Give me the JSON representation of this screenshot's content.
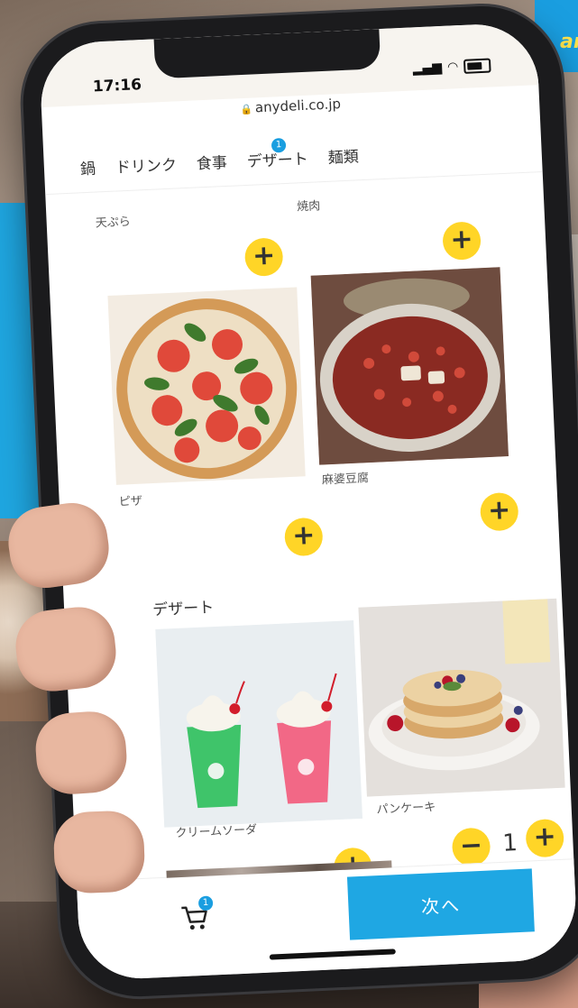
{
  "status": {
    "time": "17:16"
  },
  "url": "anydeli.co.jp",
  "tabs": [
    {
      "label": "鍋"
    },
    {
      "label": "ドリンク"
    },
    {
      "label": "食事"
    },
    {
      "label": "デザート",
      "badge": "1"
    },
    {
      "label": "麺類"
    }
  ],
  "items": {
    "tempura": {
      "label": "天ぷら"
    },
    "yakiniku": {
      "label": "焼肉"
    },
    "pizza": {
      "label": "ピザ"
    },
    "mabo": {
      "label": "麻婆豆腐"
    },
    "cream_soda": {
      "label": "クリームソーダ"
    },
    "pancake": {
      "label": "パンケーキ",
      "quantity": "1"
    }
  },
  "sections": {
    "dessert": "デザート"
  },
  "buttons": {
    "plus": "+",
    "minus": "−"
  },
  "footer": {
    "next_label": "次へ",
    "cart_badge": "1"
  },
  "colors": {
    "accent": "#1fa7e3",
    "plus_button": "#ffd527"
  },
  "background": {
    "brand_text": "an"
  }
}
